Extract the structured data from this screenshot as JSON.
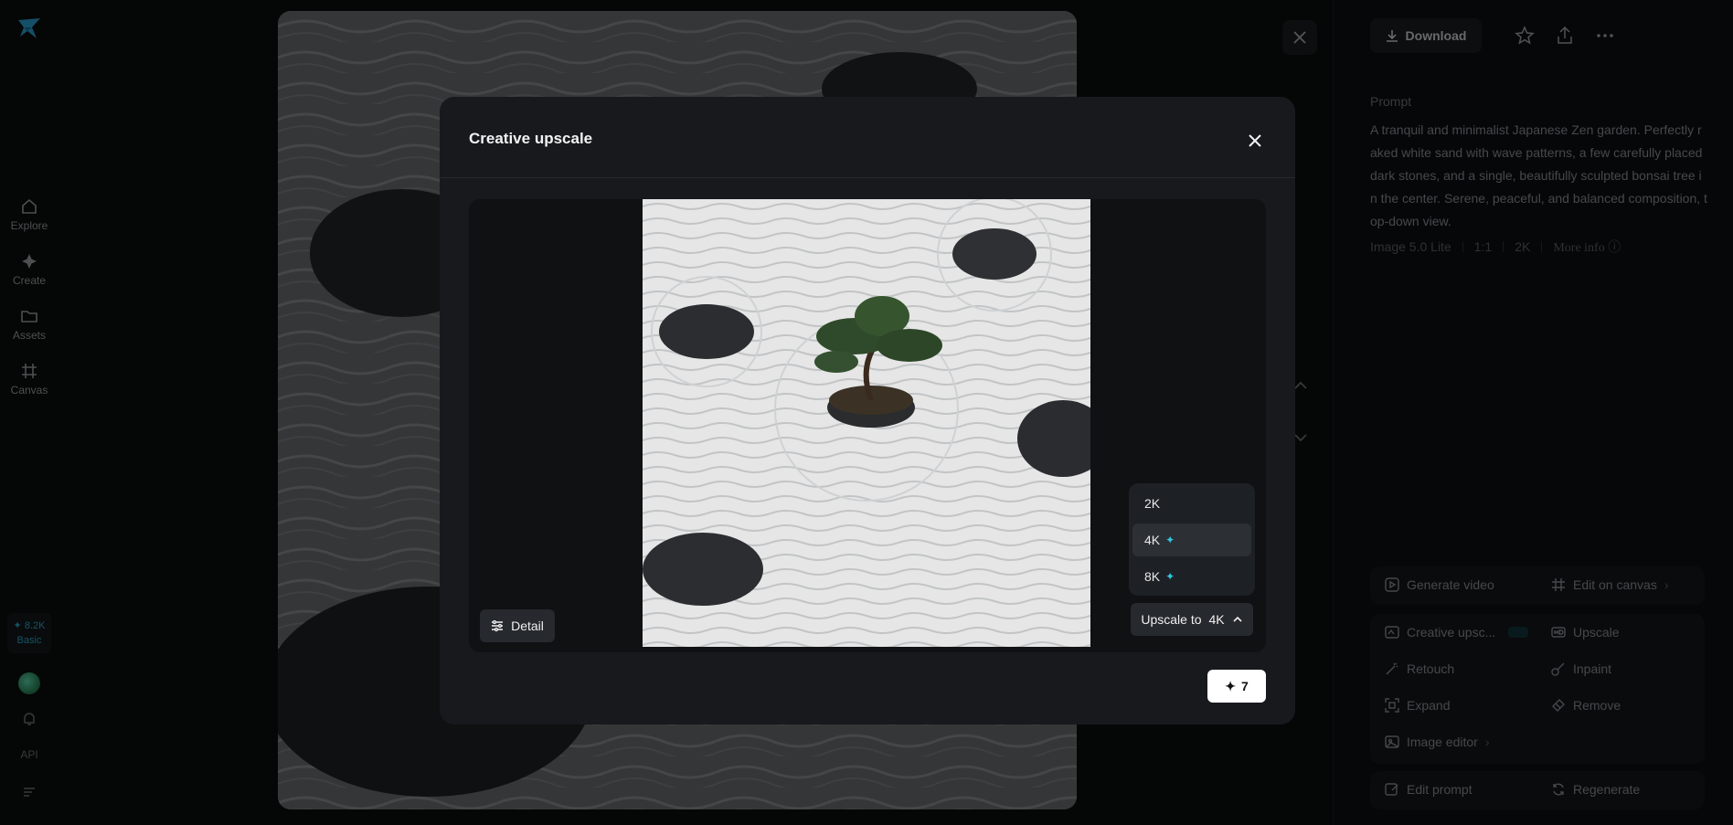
{
  "sidebar": {
    "items": [
      {
        "label": "Explore",
        "icon": "home-icon"
      },
      {
        "label": "Create",
        "icon": "sparkle-icon"
      },
      {
        "label": "Assets",
        "icon": "folder-icon"
      },
      {
        "label": "Canvas",
        "icon": "canvas-icon"
      }
    ],
    "credits_value": "✦ 8.2K",
    "credits_plan": "Basic",
    "api_label": "API"
  },
  "right_panel": {
    "download_label": "Download",
    "prompt_label": "Prompt",
    "prompt_text": "A tranquil and minimalist Japanese Zen garden. Perfectly raked white sand with wave patterns, a few carefully placed dark stones, and a single, beautifully sculpted bonsai tree in the center. Serene, peaceful, and balanced composition, top-down view.",
    "meta": {
      "model": "Image 5.0 Lite",
      "ratio": "1:1",
      "resolution": "2K",
      "more_info": "More info"
    },
    "tools": {
      "generate_video": "Generate video",
      "edit_on_canvas": "Edit on canvas",
      "creative_upscale": "Creative upsc...",
      "upscale": "Upscale",
      "retouch": "Retouch",
      "inpaint": "Inpaint",
      "expand": "Expand",
      "remove": "Remove",
      "image_editor": "Image editor",
      "edit_prompt": "Edit prompt",
      "regenerate": "Regenerate"
    }
  },
  "modal": {
    "title": "Creative upscale",
    "detail_label": "Detail",
    "upscale_prefix": "Upscale to",
    "upscale_value": "4K",
    "options": [
      {
        "label": "2K",
        "premium": false,
        "selected": false
      },
      {
        "label": "4K",
        "premium": true,
        "selected": true
      },
      {
        "label": "8K",
        "premium": true,
        "selected": false
      }
    ],
    "generate_cost": "7"
  },
  "colors": {
    "accent": "#2fc7e0",
    "modal_bg": "#17191c",
    "primary_button": "#ffffff"
  }
}
